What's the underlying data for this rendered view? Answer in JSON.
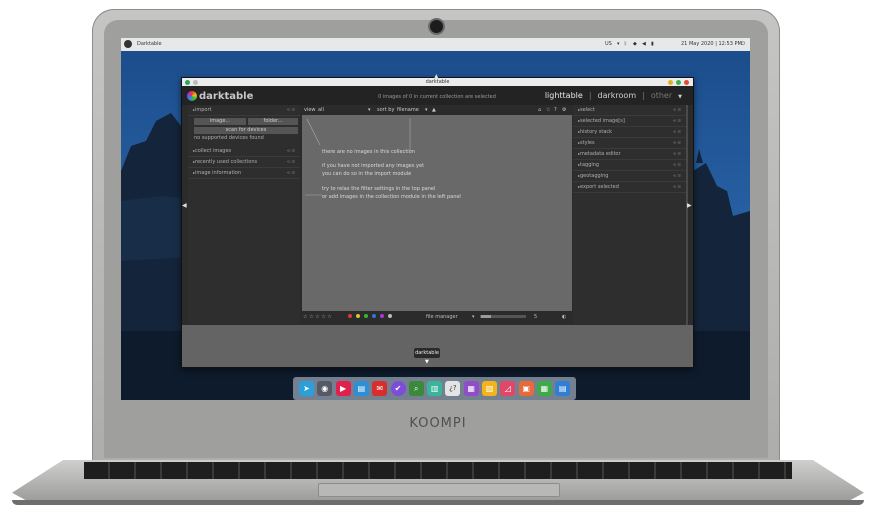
{
  "laptop": {
    "brand": "KOOMPI"
  },
  "os_topbar": {
    "app_name": "Darktable",
    "keyboard_layout": "US",
    "datetime": "21 May 2020 | 12:53 PM"
  },
  "window": {
    "title": "darktable"
  },
  "header": {
    "logo_text": "darktable",
    "collection_info": "0 images of 0 in current collection are selected",
    "views": {
      "lighttable": "lighttable",
      "separator": "|",
      "darkroom": "darkroom",
      "other": "other"
    }
  },
  "left_panel": {
    "import_label": "import",
    "image_button": "image...",
    "folder_button": "folder...",
    "scan_button": "scan for devices",
    "no_devices": "no supported devices found",
    "modules": [
      "collect images",
      "recently used collections",
      "image information"
    ]
  },
  "top_filter": {
    "view_label": "view",
    "view_value": "all",
    "sort_label": "sort by",
    "sort_value": "filename",
    "sort_dir": "▲"
  },
  "center": {
    "msg1": "there are no images in this collection",
    "msg2": "if you have not imported any images yet",
    "msg3": "you can do so in the import module",
    "msg4": "try to relax the filter settings in the top panel",
    "msg5": "or add images in the collection module in the left panel"
  },
  "bottom_bar": {
    "stars": "☆ ☆ ☆ ☆ ☆",
    "layout_value": "file manager",
    "zoom_value": "5",
    "color_labels": [
      "#d83a3a",
      "#d8c33a",
      "#3ab53a",
      "#3a6fd8",
      "#a23ad8",
      "#bcbcbc"
    ]
  },
  "right_panel": {
    "modules": [
      "select",
      "selected image[s]",
      "history stack",
      "styles",
      "metadata editor",
      "tagging",
      "geotagging",
      "export selected"
    ]
  },
  "dock": {
    "tooltip": "darktable",
    "unknown_app_glyph": "¿?",
    "apps": [
      {
        "icon": "telegram-icon",
        "color": "#2a9fd8"
      },
      {
        "icon": "screenshot-icon",
        "color": "#555a66"
      },
      {
        "icon": "media-player-icon",
        "color": "#e3204b"
      },
      {
        "icon": "file-manager-icon",
        "color": "#2f8fd6"
      },
      {
        "icon": "office-red-icon",
        "color": "#d82d2d"
      },
      {
        "icon": "darktable-active-icon",
        "color": "#7c4dd8"
      },
      {
        "icon": "search-icon",
        "color": "#3b8a3b"
      },
      {
        "icon": "trash-icon",
        "color": "#38b59a"
      },
      {
        "icon": "unknown-app-icon",
        "color": "#e4e4e4"
      },
      {
        "icon": "calculator-icon",
        "color": "#8f4ec7"
      },
      {
        "icon": "notes-icon",
        "color": "#f2b31b"
      },
      {
        "icon": "graph-icon",
        "color": "#e0486a"
      },
      {
        "icon": "presentation-icon",
        "color": "#e86a3a"
      },
      {
        "icon": "spreadsheet-icon",
        "color": "#3eaa4a"
      },
      {
        "icon": "document-icon",
        "color": "#2f7fd6"
      }
    ]
  }
}
